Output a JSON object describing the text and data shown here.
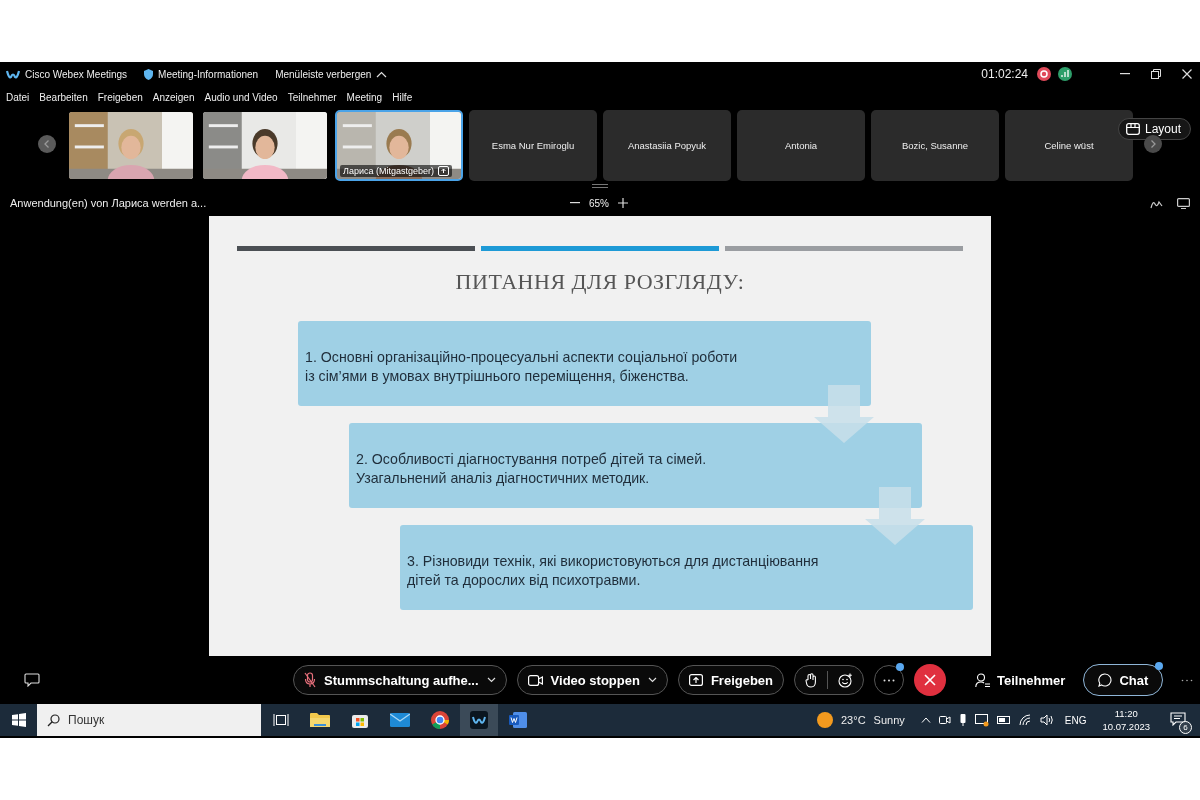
{
  "title_bar": {
    "app_title": "Cisco Webex Meetings",
    "meeting_info": "Meeting-Informationen",
    "hide_menu": "Menüleiste verbergen",
    "timer": "01:02:24"
  },
  "menu": [
    "Datei",
    "Bearbeiten",
    "Freigeben",
    "Anzeigen",
    "Audio und Video",
    "Teilnehmer",
    "Meeting",
    "Hilfe"
  ],
  "participants": [
    {
      "kind": "video",
      "active": false
    },
    {
      "kind": "video",
      "active": false
    },
    {
      "kind": "video",
      "active": true,
      "label": "Лариса (Mitgastgeber)"
    },
    {
      "kind": "name",
      "active": false,
      "name": "Esma Nur Emiroglu"
    },
    {
      "kind": "name",
      "active": false,
      "name": "Anastasiia Popyuk"
    },
    {
      "kind": "name",
      "active": false,
      "name": "Antonia"
    },
    {
      "kind": "name",
      "active": false,
      "name": "Bozic, Susanne"
    },
    {
      "kind": "name",
      "active": false,
      "name": "Celine wüst"
    }
  ],
  "layout_button": "Layout",
  "share_bar": {
    "text": "Anwendung(en) von Лариса werden a...",
    "zoom": "65%"
  },
  "slide": {
    "title": "ПИТАННЯ ДЛЯ РОЗГЛЯДУ:",
    "items": [
      {
        "lines": [
          "1. Основні організаційно-процесуальні аспекти соціальної роботи",
          "із сім’ями в умовах внутрішнього переміщення, біженства."
        ]
      },
      {
        "lines": [
          "2. Особливості діагностування потреб дітей та сімей.",
          "Узагальнений аналіз діагностичних методик."
        ]
      },
      {
        "lines": [
          "3. Різновиди технік, які використовуються для дистанціювання",
          "дітей та дорослих від психотравми."
        ]
      }
    ]
  },
  "controls": {
    "mute": {
      "label": "Stummschaltung aufhe...",
      "muted": true
    },
    "video": "Video stoppen",
    "share": "Freigeben",
    "more_badge": true,
    "participants": "Teilnehmer",
    "chat": {
      "label": "Chat",
      "badge": true
    }
  },
  "taskbar": {
    "search_placeholder": "Пошук",
    "temperature": "23°C",
    "weather": "Sunny",
    "language": "ENG",
    "time": "11:20",
    "date": "10.07.2023",
    "notifications": "6"
  }
}
